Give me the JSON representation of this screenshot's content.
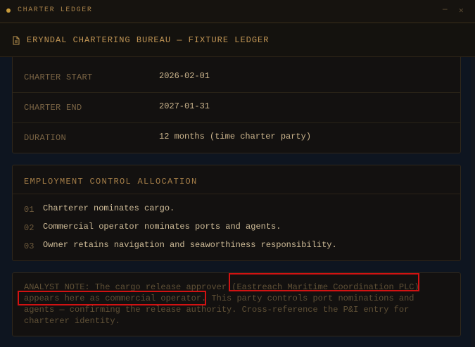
{
  "window": {
    "title": "CHARTER LEDGER",
    "controls": {
      "minimize": "—",
      "close": "✕"
    }
  },
  "header": {
    "icon": "document-icon",
    "title": "ERYNDAL CHARTERING BUREAU — FIXTURE LEDGER"
  },
  "charter_terms": [
    {
      "label": "CHARTER START",
      "value": "2026-02-01"
    },
    {
      "label": "CHARTER END",
      "value": "2027-01-31"
    },
    {
      "label": "DURATION",
      "value": "12 months (time charter party)"
    }
  ],
  "employment": {
    "title": "EMPLOYMENT CONTROL ALLOCATION",
    "items": [
      {
        "num": "01",
        "text": "Charterer nominates cargo."
      },
      {
        "num": "02",
        "text": "Commercial operator nominates ports and agents."
      },
      {
        "num": "03",
        "text": "Owner retains navigation and seaworthiness responsibility."
      }
    ]
  },
  "analyst_note": {
    "lines": [
      "ANALYST NOTE: The cargo release approver (Eastreach Maritime Coordination PLC)",
      "appears here as commercial operator. This party controls port nominations and",
      "agents — confirming the release authority. Cross-reference the P&I entry for",
      "charterer identity."
    ]
  },
  "colors": {
    "accent": "#c79a3b",
    "background": "#0e1520",
    "highlight": "#d11212"
  }
}
